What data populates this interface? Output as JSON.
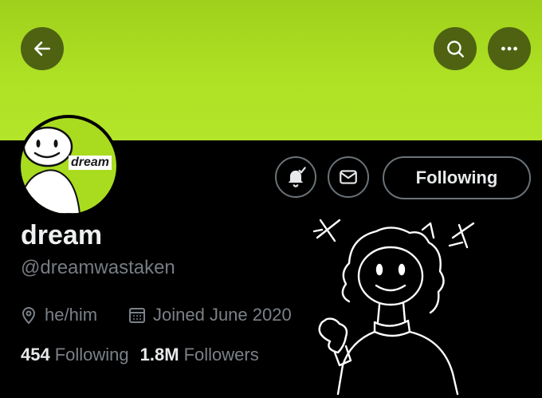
{
  "colors": {
    "banner": "#a9dc1f",
    "accent_dark": "#4e6212",
    "text": "#e7e9ea",
    "muted": "#7b8187"
  },
  "header": {
    "back_icon": "arrow-left-icon",
    "search_icon": "search-icon",
    "more_icon": "more-icon"
  },
  "avatar": {
    "text": "dream"
  },
  "actions": {
    "bell_icon": "bell-notify-icon",
    "mail_icon": "mail-icon",
    "following_label": "Following"
  },
  "profile": {
    "name": "dream",
    "handle": "@dreamwastaken",
    "pronouns": "he/him",
    "joined": "Joined June 2020"
  },
  "counts": {
    "following_count": "454",
    "following_label": "Following",
    "followers_count": "1.8M",
    "followers_label": "Followers"
  }
}
